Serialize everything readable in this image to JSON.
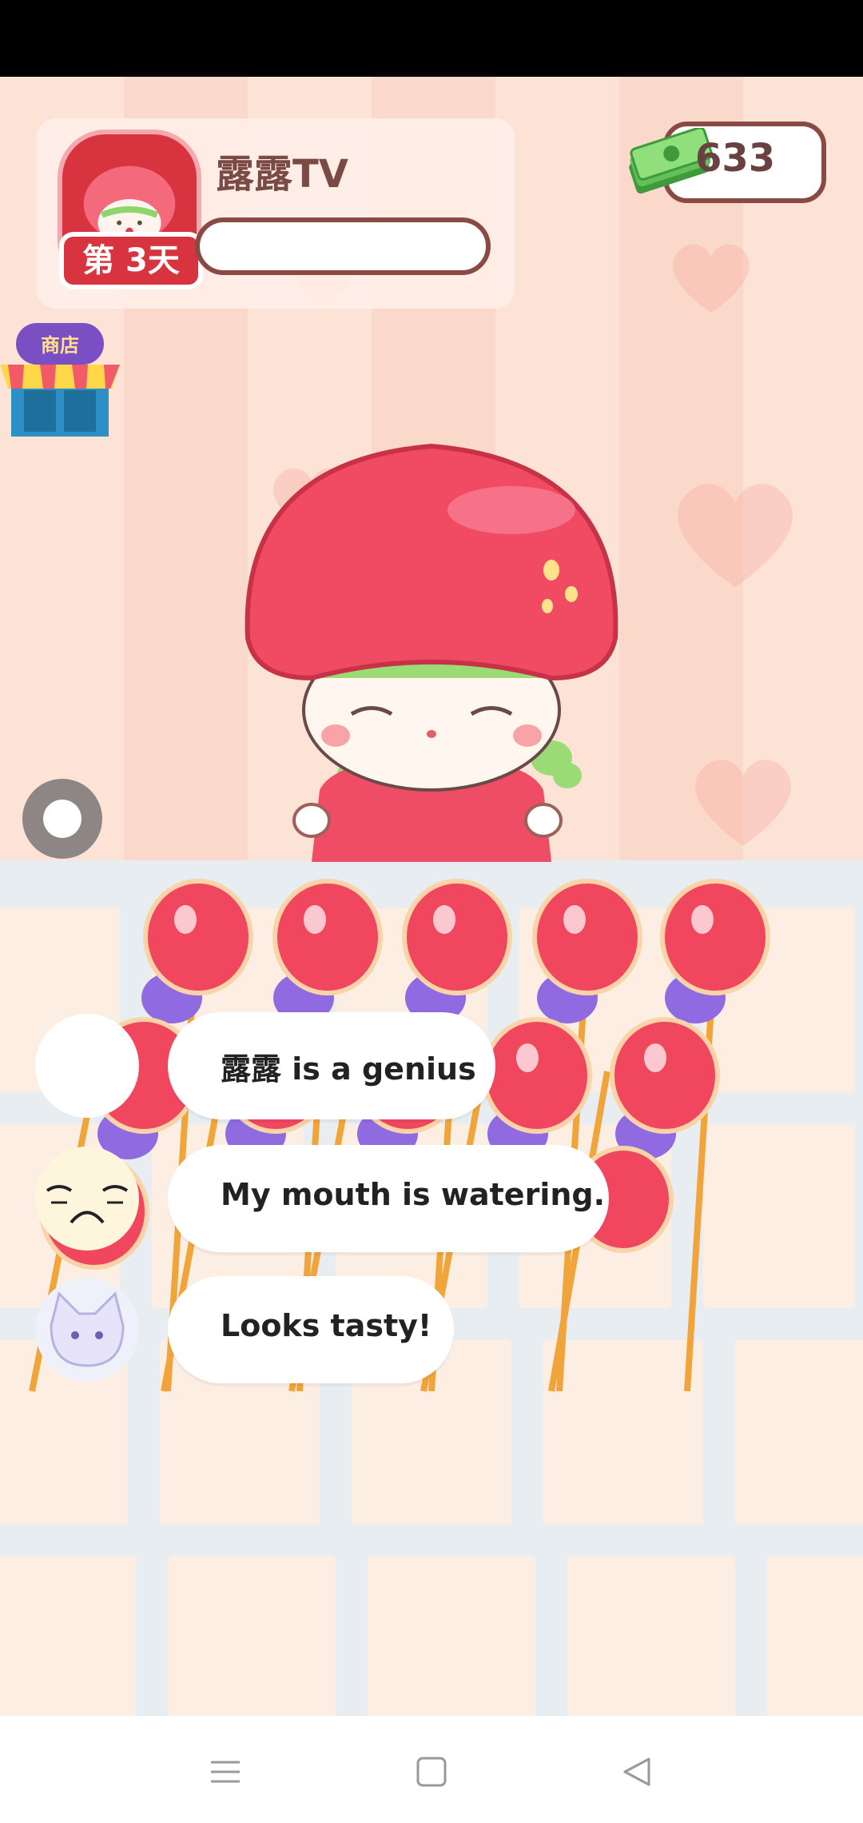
{
  "profile": {
    "channel_name": "露露TV",
    "day_label": "第 3天",
    "progress": 0
  },
  "wallet": {
    "money": "633"
  },
  "shop": {
    "label": "商店"
  },
  "comments": [
    {
      "text": "露露 is a genius"
    },
    {
      "text": "My mouth is watering."
    },
    {
      "text": "Looks tasty!"
    }
  ],
  "navbar": {
    "icons": [
      "menu-icon",
      "home-square-icon",
      "back-triangle-icon"
    ]
  },
  "colors": {
    "accent": "#d8343f",
    "frame_brown": "#8a4a44",
    "candy_red": "#f0475e",
    "candy_purple": "#8f6ae0"
  }
}
